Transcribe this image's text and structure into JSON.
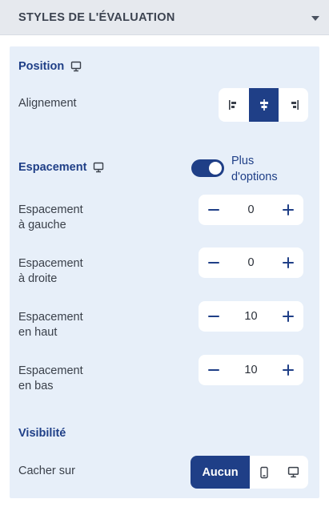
{
  "header": {
    "title": "STYLES DE L'ÉVALUATION",
    "caret_icon": "chevron-down-icon"
  },
  "position": {
    "title": "Position",
    "device_icon": "monitor-icon",
    "alignment_label": "Alignement",
    "alignment_options": [
      "align-left",
      "align-center",
      "align-right"
    ],
    "alignment_selected": "align-center"
  },
  "spacing": {
    "title": "Espacement",
    "device_icon": "monitor-icon",
    "more_options_label_line1": "Plus",
    "more_options_label_line2": "d'options",
    "more_options_enabled": true,
    "rows": [
      {
        "label_line1": "Espacement",
        "label_line2": "à gauche",
        "value": "0"
      },
      {
        "label_line1": "Espacement",
        "label_line2": "à droite",
        "value": "0"
      },
      {
        "label_line1": "Espacement",
        "label_line2": "en haut",
        "value": "10"
      },
      {
        "label_line1": "Espacement",
        "label_line2": "en bas",
        "value": "10"
      }
    ]
  },
  "visibility": {
    "title": "Visibilité",
    "hide_on_label": "Cacher sur",
    "none_label": "Aucun",
    "options": [
      "none",
      "mobile",
      "desktop"
    ],
    "selected": "none"
  },
  "colors": {
    "accent": "#1f3f87",
    "panel_bg": "#e7eff9",
    "header_bg": "#e6e9ee"
  }
}
